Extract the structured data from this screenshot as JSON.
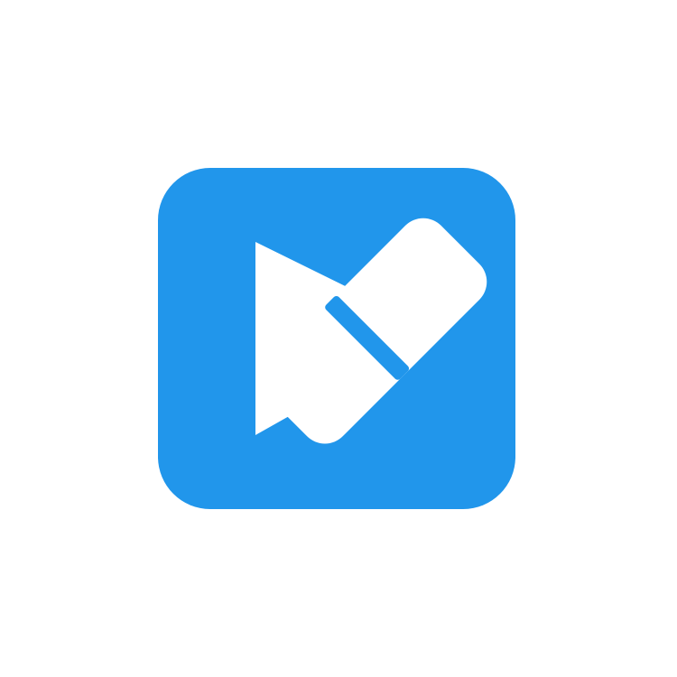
{
  "colors": {
    "background": "#ffffff",
    "icon_background": "#2196eb",
    "icon_foreground": "#ffffff"
  },
  "icon": {
    "name": "play-eraser-icon"
  }
}
